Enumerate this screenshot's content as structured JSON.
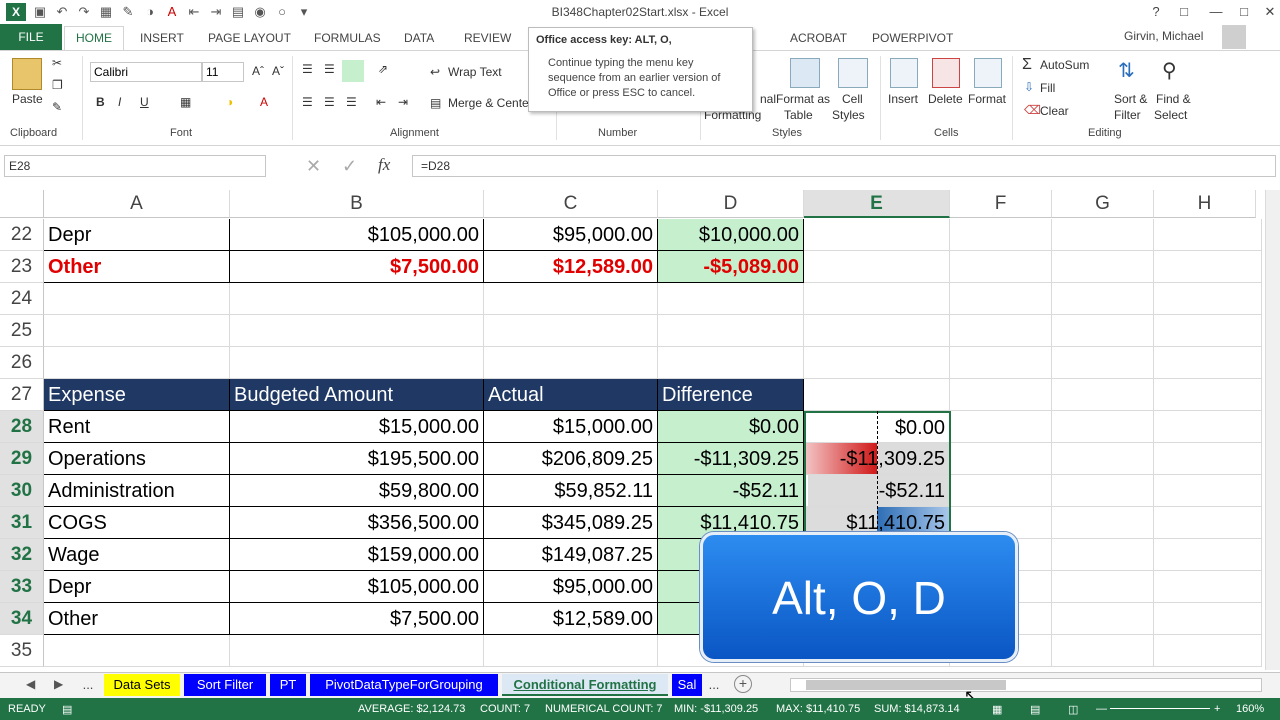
{
  "window": {
    "title": "BI348Chapter02Start.xlsx - Excel",
    "user": "Girvin, Michael"
  },
  "ribbon_tabs": [
    "FILE",
    "HOME",
    "INSERT",
    "PAGE LAYOUT",
    "FORMULAS",
    "DATA",
    "REVIEW",
    "ACROBAT",
    "POWERPIVOT"
  ],
  "ribbon": {
    "paste": "Paste",
    "font_name": "Calibri",
    "font_size": "11",
    "bold": "B",
    "italic": "I",
    "underline": "U",
    "wrap_text": "Wrap Text",
    "merge_center": "Merge & Cente",
    "conditional_formatting_partial": "nal",
    "conditional_formatting_partial2": "Formatting",
    "format_as_table": "Format as",
    "format_as_table2": "Table",
    "cell_styles": "Cell",
    "cell_styles2": "Styles",
    "insert": "Insert",
    "delete": "Delete",
    "format": "Format",
    "autosum": "AutoSum",
    "fill": "Fill",
    "clear": "Clear",
    "sort_filter": "Sort &",
    "sort_filter2": "Filter",
    "find_select": "Find &",
    "find_select2": "Select",
    "groups": {
      "clipboard": "Clipboard",
      "font": "Font",
      "alignment": "Alignment",
      "number": "Number",
      "styles": "Styles",
      "cells": "Cells",
      "editing": "Editing"
    }
  },
  "tooltip": {
    "title": "Office access key: ALT, O,",
    "body": "Continue typing the menu key sequence from an earlier version of Office or press ESC to cancel."
  },
  "formula_bar": {
    "name_box": "E28",
    "fx": "fx",
    "formula": "=D28"
  },
  "columns": [
    "A",
    "B",
    "C",
    "D",
    "E",
    "F",
    "G",
    "H"
  ],
  "rows": [
    {
      "num": "22",
      "a": "Depr",
      "b": "$105,000.00",
      "c": "$95,000.00",
      "d": "$10,000.00",
      "e": ""
    },
    {
      "num": "23",
      "a": "Other",
      "b": "$7,500.00",
      "c": "$12,589.00",
      "d": "-$5,089.00",
      "e": ""
    },
    {
      "num": "24",
      "a": "",
      "b": "",
      "c": "",
      "d": "",
      "e": ""
    },
    {
      "num": "25",
      "a": "",
      "b": "",
      "c": "",
      "d": "",
      "e": ""
    },
    {
      "num": "26",
      "a": "",
      "b": "",
      "c": "",
      "d": "",
      "e": ""
    },
    {
      "num": "27",
      "a": "Expense",
      "b": "Budgeted Amount",
      "c": "Actual",
      "d": "Difference",
      "e": ""
    },
    {
      "num": "28",
      "a": "Rent",
      "b": "$15,000.00",
      "c": "$15,000.00",
      "d": "$0.00",
      "e": "$0.00"
    },
    {
      "num": "29",
      "a": "Operations",
      "b": "$195,500.00",
      "c": "$206,809.25",
      "d": "-$11,309.25",
      "e": "-$11,309.25"
    },
    {
      "num": "30",
      "a": "Administration",
      "b": "$59,800.00",
      "c": "$59,852.11",
      "d": "-$52.11",
      "e": "-$52.11"
    },
    {
      "num": "31",
      "a": "COGS",
      "b": "$356,500.00",
      "c": "$345,089.25",
      "d": "$11,410.75",
      "e": "$11,410.75"
    },
    {
      "num": "32",
      "a": "Wage",
      "b": "$159,000.00",
      "c": "$149,087.25",
      "d": "",
      "e": ""
    },
    {
      "num": "33",
      "a": "Depr",
      "b": "$105,000.00",
      "c": "$95,000.00",
      "d": "$",
      "e": ""
    },
    {
      "num": "34",
      "a": "Other",
      "b": "$7,500.00",
      "c": "$12,589.00",
      "d": "",
      "e": ""
    },
    {
      "num": "35",
      "a": "",
      "b": "",
      "c": "",
      "d": "",
      "e": ""
    }
  ],
  "overlay": {
    "keys": "Alt, O, D"
  },
  "sheet_tabs": [
    "...",
    "Data Sets",
    "Sort Filter",
    "PT",
    "PivotDataTypeForGrouping",
    "Conditional Formatting",
    "Sal",
    "..."
  ],
  "status": {
    "mode": "READY",
    "average": "AVERAGE: $2,124.73",
    "count": "COUNT: 7",
    "numerical_count": "NUMERICAL COUNT: 7",
    "min": "MIN: -$11,309.25",
    "max": "MAX: $11,410.75",
    "sum": "SUM: $14,873.14",
    "zoom": "160%"
  },
  "colors": {
    "excel_green": "#217346",
    "header_navy": "#1f3864",
    "diff_green": "#c6efce",
    "negative_red": "#e00000",
    "badge_blue": "#1a6fdc"
  }
}
